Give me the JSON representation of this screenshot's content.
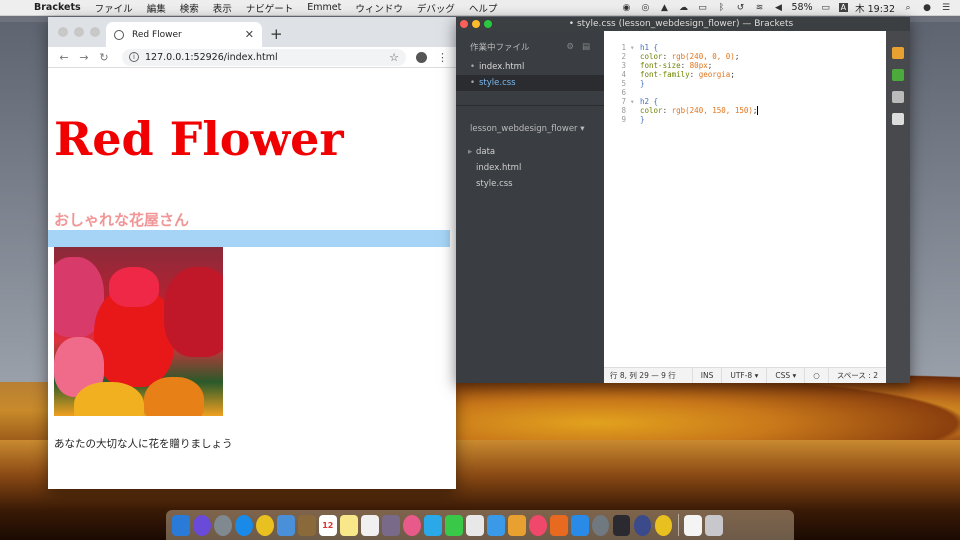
{
  "menubar": {
    "app_name": "Brackets",
    "items": [
      "ファイル",
      "編集",
      "検索",
      "表示",
      "ナビゲート",
      "Emmet",
      "ウィンドウ",
      "デバッグ",
      "ヘルプ"
    ],
    "battery": "58%",
    "input_badge": "A",
    "clock": "木 19:32"
  },
  "browser": {
    "tab_title": "Red Flower",
    "tab_close": "✕",
    "new_tab": "+",
    "url": "127.0.0.1:52926/index.html",
    "page": {
      "h1": "Red Flower",
      "h2": "おしゃれな花屋さん",
      "paragraph": "あなたの大切な人に花を贈りましょう"
    }
  },
  "brackets": {
    "window_title": "• style.css (lesson_webdesign_flower) — Brackets",
    "sidebar": {
      "working_files_label": "作業中ファイル",
      "working_files": [
        "index.html",
        "style.css"
      ],
      "project_name": "lesson_webdesign_flower ▾",
      "tree": [
        "data",
        "index.html",
        "style.css"
      ]
    },
    "code_lines": [
      {
        "n": "1",
        "fold": "▾",
        "text": "h1 {"
      },
      {
        "n": "2",
        "fold": "",
        "text": "  color: rgb(240, 0, 0);"
      },
      {
        "n": "3",
        "fold": "",
        "text": "  font-size: 80px;"
      },
      {
        "n": "4",
        "fold": "",
        "text": "  font-family: georgia;"
      },
      {
        "n": "5",
        "fold": "",
        "text": "}"
      },
      {
        "n": "6",
        "fold": "",
        "text": ""
      },
      {
        "n": "7",
        "fold": "▾",
        "text": "h2 {"
      },
      {
        "n": "8",
        "fold": "",
        "text": "  color: rgb(240, 150, 150);"
      },
      {
        "n": "9",
        "fold": "",
        "text": "}"
      }
    ],
    "status": {
      "position": "行 8, 列 29 — 9 行",
      "mode": "INS",
      "encoding": "UTF-8 ▾",
      "language": "CSS ▾",
      "indent": "スペース : 2"
    }
  },
  "dock": {
    "calendar_day": "12"
  },
  "colors": {
    "h1": "#f00000",
    "h2": "#f09696",
    "h2_bars": "#a6d4f6"
  }
}
